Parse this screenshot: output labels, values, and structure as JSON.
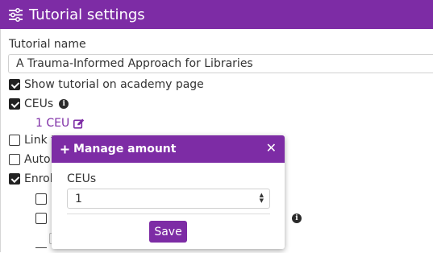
{
  "header": {
    "title": "Tutorial settings",
    "icon": "sliders-icon"
  },
  "form": {
    "name_label": "Tutorial name",
    "name_value": "A Trauma-Informed Approach for Libraries",
    "show_tutorial_label": "Show tutorial on academy page",
    "ceus_label": "CEUs",
    "ceu_link": "1 CEU",
    "link_label": "Link to",
    "auto_label": "Auto c",
    "enroll_label": "Enroll"
  },
  "modal": {
    "title": "Manage amount",
    "ceus_label": "CEUs",
    "ceus_value": "1",
    "save_label": "Save"
  },
  "colors": {
    "accent": "#7d2ca5"
  }
}
